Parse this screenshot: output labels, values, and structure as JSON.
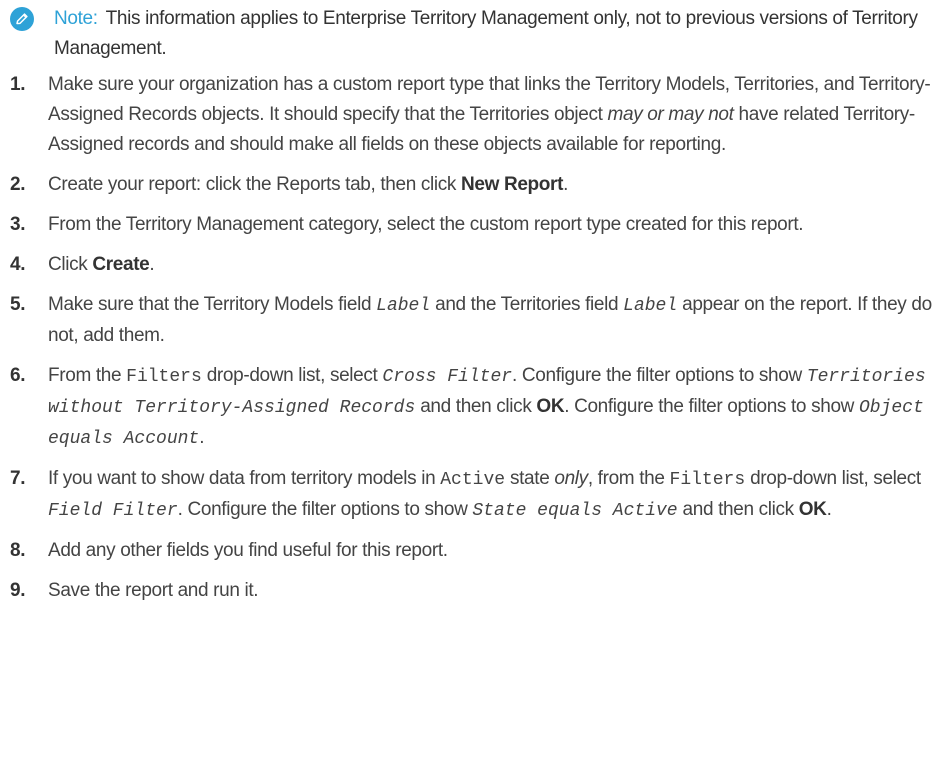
{
  "note": {
    "label": "Note:",
    "text": "This information applies to Enterprise Territory Management only, not to previous versions of Territory Management.",
    "icon": "edit-note-icon",
    "accent_color": "#2ea2d7"
  },
  "steps": [
    {
      "num": "1.",
      "parts": [
        "Make sure your organization has a custom report type that links the Territory Models, Territories, and Territory-Assigned Records objects. It should specify that the Territories object ",
        "may or may not",
        " have related Territory-Assigned records and should make all fields on these objects available for reporting."
      ]
    },
    {
      "num": "2.",
      "parts": [
        "Create your report: click the Reports tab, then click ",
        "New Report",
        "."
      ]
    },
    {
      "num": "3.",
      "parts": [
        "From the Territory Management category, select the custom report type created for this report."
      ]
    },
    {
      "num": "4.",
      "parts": [
        "Click ",
        "Create",
        "."
      ]
    },
    {
      "num": "5.",
      "parts": [
        "Make sure that the Territory Models field ",
        "Label",
        " and the Territories field ",
        "Label",
        " appear on the report. If they do not, add them."
      ]
    },
    {
      "num": "6.",
      "parts": [
        "From the ",
        "Filters",
        " drop-down list, select ",
        "Cross Filter",
        ". Configure the filter options to show ",
        "Territories without Territory-Assigned Records",
        " and then click ",
        "OK",
        ". Configure the filter options to show ",
        "Object equals Account",
        "."
      ]
    },
    {
      "num": "7.",
      "parts": [
        "If you want to show data from territory models in ",
        "Active",
        " state ",
        "only",
        ", from the ",
        "Filters",
        " drop-down list, select ",
        "Field Filter",
        ". Configure the filter options to show ",
        "State equals Active",
        " and then click ",
        "OK",
        "."
      ]
    },
    {
      "num": "8.",
      "parts": [
        "Add any other fields you find useful for this report."
      ]
    },
    {
      "num": "9.",
      "parts": [
        "Save the report and run it."
      ]
    }
  ]
}
